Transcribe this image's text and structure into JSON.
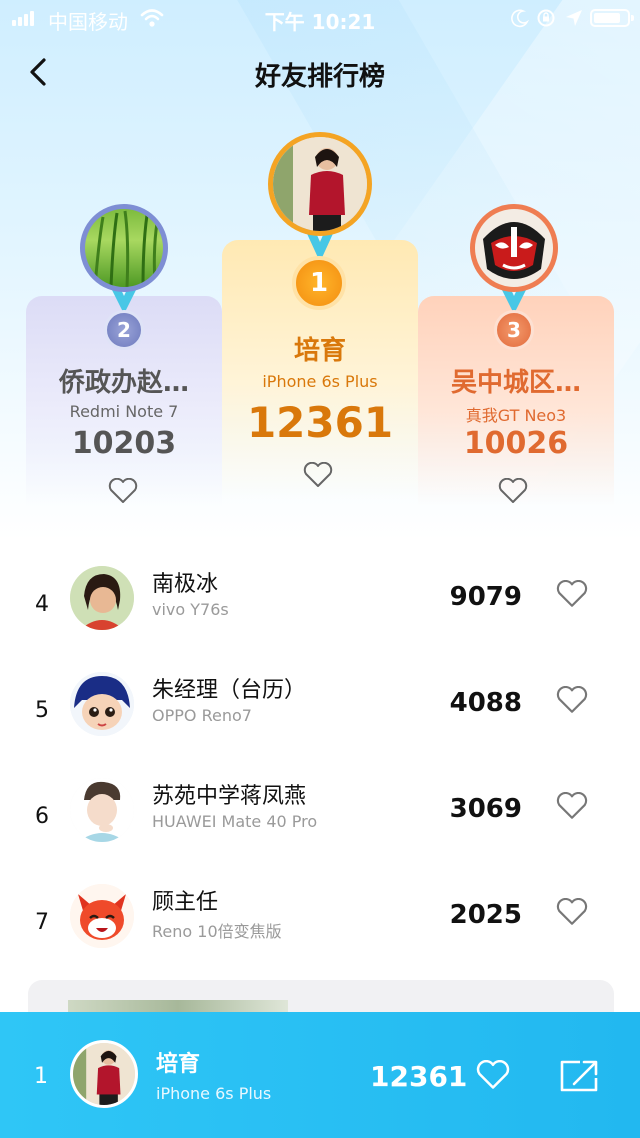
{
  "status_bar": {
    "carrier": "中国移动",
    "time": "下午 10:21"
  },
  "nav": {
    "title": "好友排行榜"
  },
  "podium": [
    {
      "rank": "2",
      "name": "侨政办赵…",
      "device": "Redmi Note 7",
      "score": "10203",
      "color": "#7a86c8"
    },
    {
      "rank": "1",
      "name": "培育",
      "device": "iPhone 6s Plus",
      "score": "12361",
      "color": "#f39a1b"
    },
    {
      "rank": "3",
      "name": "吴中城区…",
      "device": "真我GT Neo3",
      "score": "10026",
      "color": "#ee7a4a"
    }
  ],
  "list": [
    {
      "rank": "4",
      "name": "南极冰",
      "device": "vivo Y76s",
      "score": "9079"
    },
    {
      "rank": "5",
      "name": "朱经理（台历）",
      "device": "OPPO Reno7",
      "score": "4088"
    },
    {
      "rank": "6",
      "name": "苏苑中学蒋凤燕",
      "device": "HUAWEI Mate 40 Pro",
      "score": "3069"
    },
    {
      "rank": "7",
      "name": "顾主任",
      "device": "Reno 10倍变焦版",
      "score": "2025"
    }
  ],
  "my_rank": {
    "rank": "1",
    "name": "培育",
    "device": "iPhone 6s Plus",
    "score": "12361"
  },
  "icons": [
    "back-arrow-icon",
    "heart-icon",
    "share-icon",
    "wifi-icon",
    "battery-icon",
    "location-arrow-icon",
    "moon-icon",
    "rotation-lock-icon"
  ]
}
